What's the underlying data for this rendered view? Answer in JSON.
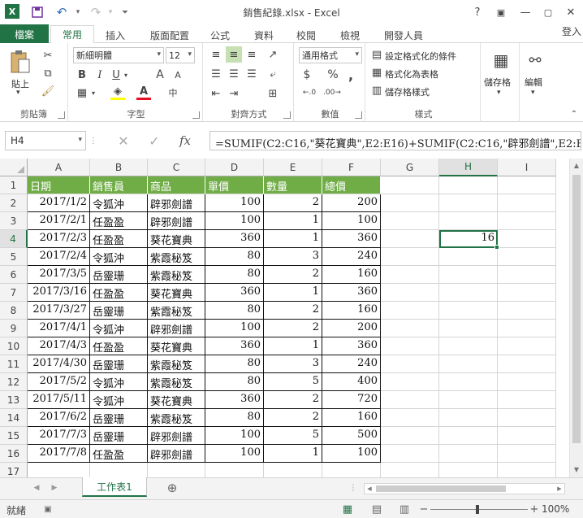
{
  "window": {
    "title": "銷售紀錄.xlsx - Excel",
    "help": "?",
    "signin": "登入"
  },
  "tabs": {
    "file": "檔案",
    "items": [
      "常用",
      "插入",
      "版面配置",
      "公式",
      "資料",
      "校閱",
      "檢視",
      "開發人員"
    ],
    "active": "常用"
  },
  "ribbon": {
    "clipboard": {
      "label": "剪貼簿",
      "paste": "貼上"
    },
    "font": {
      "label": "字型",
      "name": "新細明體",
      "size": "12",
      "bold": "B",
      "italic": "I",
      "underline": "U",
      "grow": "A",
      "shrink": "A",
      "phonetic": "中",
      "font_color_letter": "A"
    },
    "alignment": {
      "label": "對齊方式"
    },
    "number": {
      "label": "數值",
      "format": "通用格式",
      "currency": "$",
      "percent": "%",
      "comma": ","
    },
    "styles": {
      "label": "樣式",
      "conditional": "設定格式化的條件",
      "as_table": "格式化為表格",
      "cell_styles": "儲存格樣式"
    },
    "cells": {
      "label": "儲存格"
    },
    "editing": {
      "label": "編輯"
    }
  },
  "formula_bar": {
    "name_box": "H4",
    "formula": "=SUMIF(C2:C16,\"葵花寶典\",E2:E16)+SUMIF(C2:C16,\"辟邪劍譜\",E2:E16)",
    "cancel": "✕",
    "enter": "✓",
    "fx": "fx"
  },
  "grid": {
    "columns": [
      "A",
      "B",
      "C",
      "D",
      "E",
      "F",
      "G",
      "H",
      "I"
    ],
    "rows": [
      "1",
      "2",
      "3",
      "4",
      "5",
      "6",
      "7",
      "8",
      "9",
      "10",
      "11",
      "12",
      "13",
      "14",
      "15",
      "16",
      "17"
    ],
    "selected_column": "H",
    "selected_row": "4",
    "headers": [
      "日期",
      "銷售員",
      "商品",
      "單價",
      "數量",
      "總價"
    ],
    "data": [
      [
        "2017/1/2",
        "令狐沖",
        "辟邪劍譜",
        "100",
        "2",
        "200"
      ],
      [
        "2017/2/1",
        "任盈盈",
        "辟邪劍譜",
        "100",
        "1",
        "100"
      ],
      [
        "2017/2/3",
        "任盈盈",
        "葵花寶典",
        "360",
        "1",
        "360"
      ],
      [
        "2017/2/4",
        "令狐沖",
        "紫霞秘笈",
        "80",
        "3",
        "240"
      ],
      [
        "2017/3/5",
        "岳靈珊",
        "紫霞秘笈",
        "80",
        "2",
        "160"
      ],
      [
        "2017/3/16",
        "任盈盈",
        "葵花寶典",
        "360",
        "1",
        "360"
      ],
      [
        "2017/3/27",
        "岳靈珊",
        "紫霞秘笈",
        "80",
        "2",
        "160"
      ],
      [
        "2017/4/1",
        "令狐沖",
        "辟邪劍譜",
        "100",
        "2",
        "200"
      ],
      [
        "2017/4/3",
        "任盈盈",
        "葵花寶典",
        "360",
        "1",
        "360"
      ],
      [
        "2017/4/30",
        "岳靈珊",
        "紫霞秘笈",
        "80",
        "3",
        "240"
      ],
      [
        "2017/5/2",
        "令狐沖",
        "紫霞秘笈",
        "80",
        "5",
        "400"
      ],
      [
        "2017/5/11",
        "令狐沖",
        "葵花寶典",
        "360",
        "2",
        "720"
      ],
      [
        "2017/6/2",
        "岳靈珊",
        "紫霞秘笈",
        "80",
        "2",
        "160"
      ],
      [
        "2017/7/3",
        "岳靈珊",
        "辟邪劍譜",
        "100",
        "5",
        "500"
      ],
      [
        "2017/7/8",
        "任盈盈",
        "辟邪劍譜",
        "100",
        "1",
        "100"
      ]
    ],
    "h4_value": "16"
  },
  "sheets": {
    "active": "工作表1",
    "add": "⊕"
  },
  "status": {
    "ready": "就緒",
    "zoom": "100%"
  },
  "colors": {
    "accent": "#217346",
    "table_header": "#70ad47"
  }
}
